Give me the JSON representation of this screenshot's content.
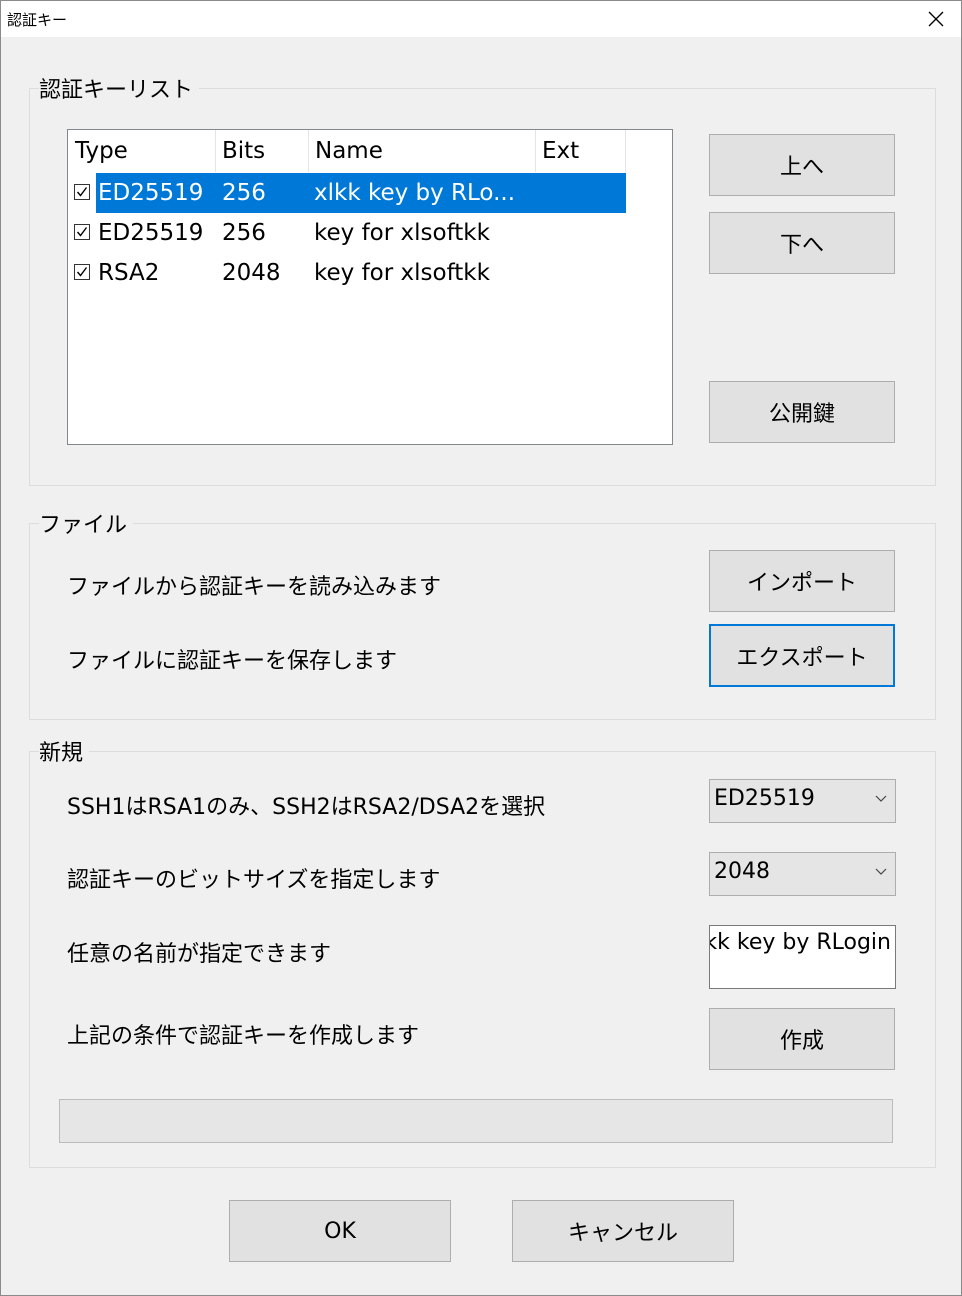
{
  "window": {
    "title": "認証キー"
  },
  "keylist": {
    "group_label": "認証キーリスト",
    "columns": [
      "Type",
      "Bits",
      "Name",
      "Ext"
    ],
    "rows": [
      {
        "checked": true,
        "type": "ED25519",
        "bits": "256",
        "name": "xlkk key by RLo...",
        "ext": "",
        "selected": true
      },
      {
        "checked": true,
        "type": "ED25519",
        "bits": "256",
        "name": "key for xlsoftkk",
        "ext": "",
        "selected": false
      },
      {
        "checked": true,
        "type": "RSA2",
        "bits": "2048",
        "name": "key for xlsoftkk",
        "ext": "",
        "selected": false
      }
    ],
    "up_button": "上へ",
    "down_button": "下へ",
    "public_key_button": "公開鍵"
  },
  "file": {
    "group_label": "ファイル",
    "import_text": "ファイルから認証キーを読み込みます",
    "import_button": "インポート",
    "export_text": "ファイルに認証キーを保存します",
    "export_button": "エクスポート"
  },
  "new": {
    "group_label": "新規",
    "type_text": "SSH1はRSA1のみ、SSH2はRSA2/DSA2を選択",
    "type_value": "ED25519",
    "bits_text": "認証キーのビットサイズを指定します",
    "bits_value": "2048",
    "name_text": "任意の名前が指定できます",
    "name_value": "xlkk key by RLogin",
    "create_text": "上記の条件で認証キーを作成します",
    "create_button": "作成",
    "progress": 0
  },
  "footer": {
    "ok_button": "OK",
    "cancel_button": "キャンセル"
  },
  "colors": {
    "selection": "#0078d7",
    "focus_border": "#0078d7",
    "button_face": "#e1e1e1"
  }
}
